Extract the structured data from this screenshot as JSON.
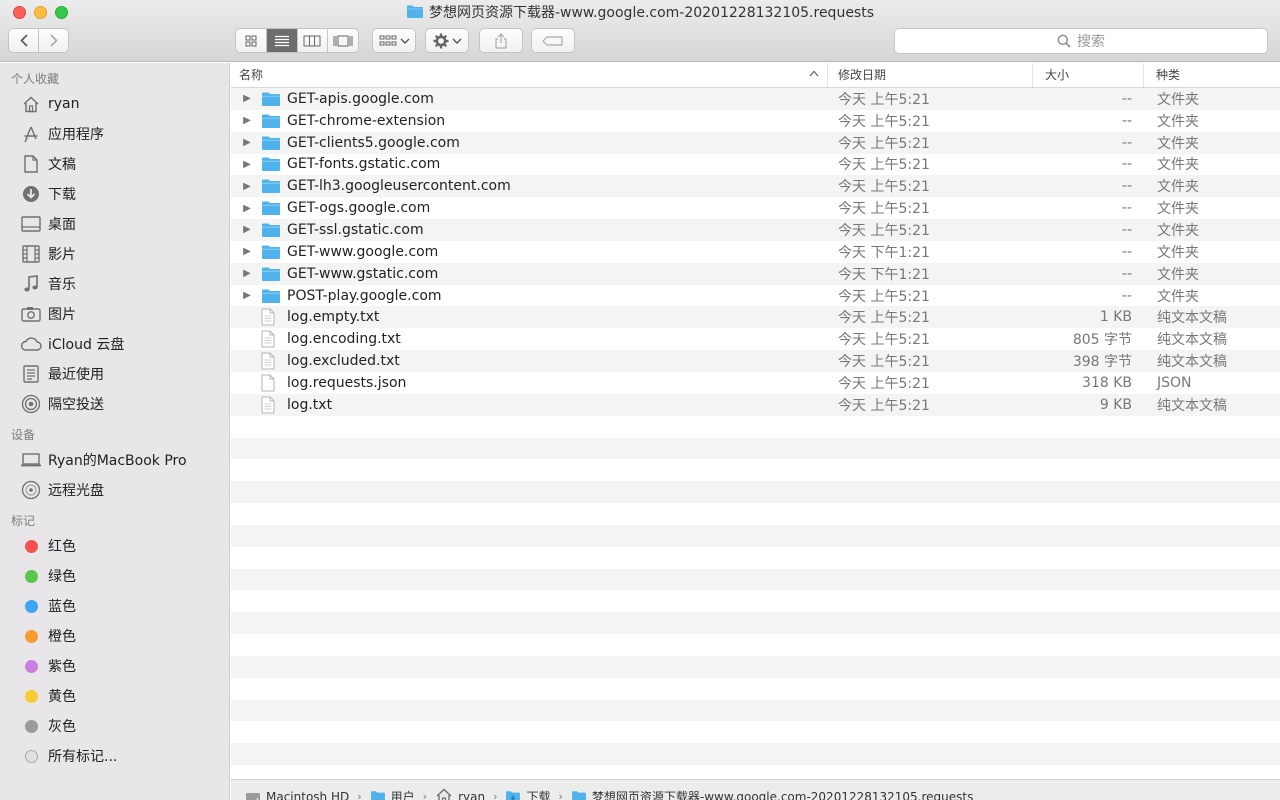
{
  "window": {
    "title": "梦想网页资源下载器-www.google.com-20201228132105.requests"
  },
  "search": {
    "placeholder": "搜索"
  },
  "sidebar": {
    "favorites_title": "个人收藏",
    "favorites": [
      {
        "label": "ryan",
        "icon": "home-icon"
      },
      {
        "label": "应用程序",
        "icon": "applications-icon"
      },
      {
        "label": "文稿",
        "icon": "documents-icon"
      },
      {
        "label": "下载",
        "icon": "downloads-icon"
      },
      {
        "label": "桌面",
        "icon": "desktop-icon"
      },
      {
        "label": "影片",
        "icon": "movies-icon"
      },
      {
        "label": "音乐",
        "icon": "music-icon"
      },
      {
        "label": "图片",
        "icon": "pictures-icon"
      },
      {
        "label": "iCloud 云盘",
        "icon": "icloud-icon"
      },
      {
        "label": "最近使用",
        "icon": "recents-icon"
      },
      {
        "label": "隔空投送",
        "icon": "airdrop-icon"
      }
    ],
    "devices_title": "设备",
    "devices": [
      {
        "label": "Ryan的MacBook Pro",
        "icon": "laptop-icon"
      },
      {
        "label": "远程光盘",
        "icon": "remote-disc-icon"
      }
    ],
    "tags_title": "标记",
    "tags": [
      {
        "label": "红色",
        "color": "#f5514d"
      },
      {
        "label": "绿色",
        "color": "#5ac54f"
      },
      {
        "label": "蓝色",
        "color": "#3aa6f4"
      },
      {
        "label": "橙色",
        "color": "#f99a2e"
      },
      {
        "label": "紫色",
        "color": "#c97ee0"
      },
      {
        "label": "黄色",
        "color": "#f7cd2d"
      },
      {
        "label": "灰色",
        "color": "#9b9b9b"
      },
      {
        "label": "所有标记...",
        "color": ""
      }
    ]
  },
  "columns": {
    "name": "名称",
    "date": "修改日期",
    "size": "大小",
    "kind": "种类"
  },
  "files": [
    {
      "name": "GET-apis.google.com",
      "date": "今天 上午5:21",
      "size": "--",
      "kind": "文件夹",
      "type": "folder"
    },
    {
      "name": "GET-chrome-extension",
      "date": "今天 上午5:21",
      "size": "--",
      "kind": "文件夹",
      "type": "folder"
    },
    {
      "name": "GET-clients5.google.com",
      "date": "今天 上午5:21",
      "size": "--",
      "kind": "文件夹",
      "type": "folder"
    },
    {
      "name": "GET-fonts.gstatic.com",
      "date": "今天 上午5:21",
      "size": "--",
      "kind": "文件夹",
      "type": "folder"
    },
    {
      "name": "GET-lh3.googleusercontent.com",
      "date": "今天 上午5:21",
      "size": "--",
      "kind": "文件夹",
      "type": "folder"
    },
    {
      "name": "GET-ogs.google.com",
      "date": "今天 上午5:21",
      "size": "--",
      "kind": "文件夹",
      "type": "folder"
    },
    {
      "name": "GET-ssl.gstatic.com",
      "date": "今天 上午5:21",
      "size": "--",
      "kind": "文件夹",
      "type": "folder"
    },
    {
      "name": "GET-www.google.com",
      "date": "今天 下午1:21",
      "size": "--",
      "kind": "文件夹",
      "type": "folder"
    },
    {
      "name": "GET-www.gstatic.com",
      "date": "今天 下午1:21",
      "size": "--",
      "kind": "文件夹",
      "type": "folder"
    },
    {
      "name": "POST-play.google.com",
      "date": "今天 上午5:21",
      "size": "--",
      "kind": "文件夹",
      "type": "folder"
    },
    {
      "name": "log.empty.txt",
      "date": "今天 上午5:21",
      "size": "1 KB",
      "kind": "纯文本文稿",
      "type": "file"
    },
    {
      "name": "log.encoding.txt",
      "date": "今天 上午5:21",
      "size": "805 字节",
      "kind": "纯文本文稿",
      "type": "file"
    },
    {
      "name": "log.excluded.txt",
      "date": "今天 上午5:21",
      "size": "398 字节",
      "kind": "纯文本文稿",
      "type": "file"
    },
    {
      "name": "log.requests.json",
      "date": "今天 上午5:21",
      "size": "318 KB",
      "kind": "JSON",
      "type": "file"
    },
    {
      "name": "log.txt",
      "date": "今天 上午5:21",
      "size": "9 KB",
      "kind": "纯文本文稿",
      "type": "file"
    }
  ],
  "pathbar": [
    {
      "label": "Macintosh HD",
      "icon": "hard-drive-icon"
    },
    {
      "label": "用户",
      "icon": "folder-icon"
    },
    {
      "label": "ryan",
      "icon": "home-icon"
    },
    {
      "label": "下载",
      "icon": "downloads-folder-icon"
    },
    {
      "label": "梦想网页资源下载器-www.google.com-20201228132105.requests",
      "icon": "folder-icon"
    }
  ],
  "colors": {
    "folder": "#4fb2ea",
    "sidebar_bg": "#e8e6e8",
    "selected_view": "#6d6d6d"
  }
}
